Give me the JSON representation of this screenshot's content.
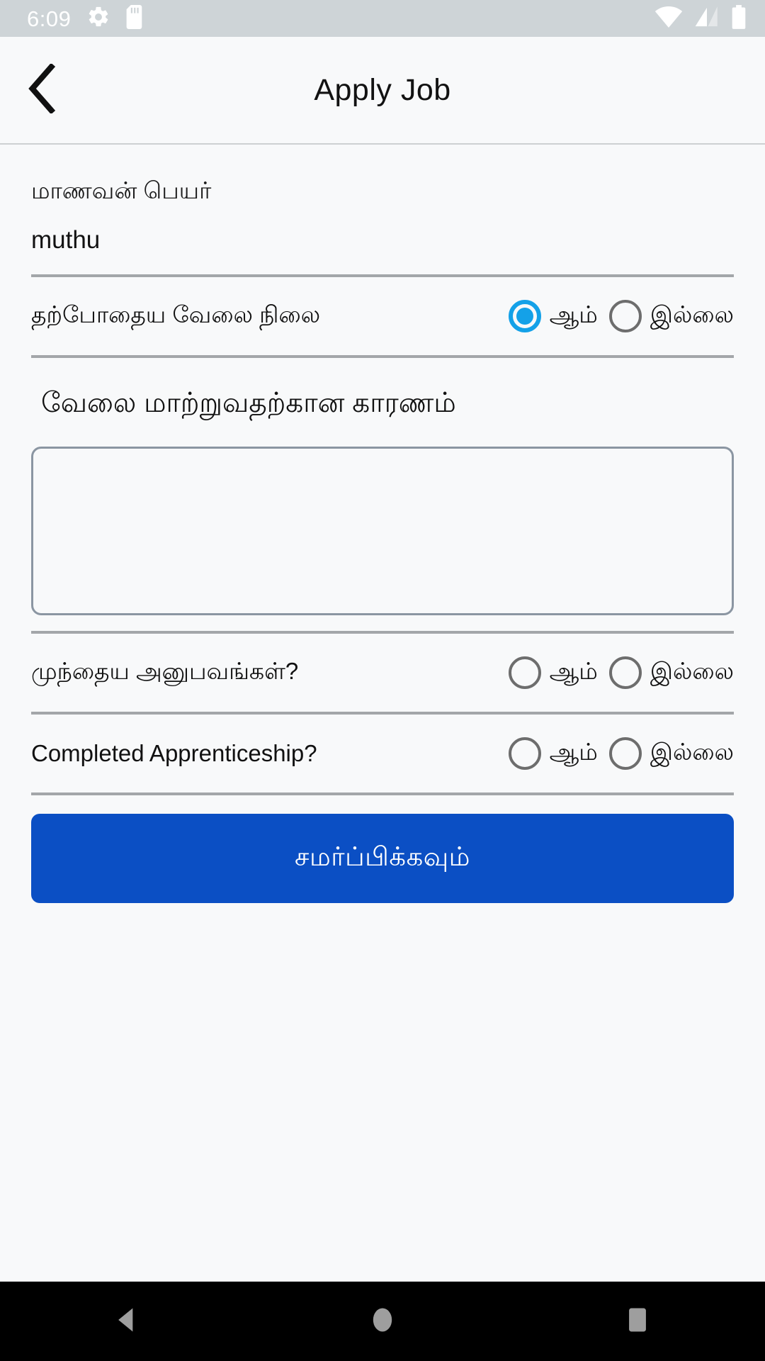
{
  "status_bar": {
    "time": "6:09",
    "left_icons": [
      "settings-gear-icon",
      "sd-card-icon"
    ],
    "right_icons": [
      "wifi-icon",
      "cellular-signal-icon",
      "battery-icon"
    ],
    "background_color": "#ced4d7",
    "icon_color": "#ffffff"
  },
  "app_bar": {
    "back_icon": "chevron-left-icon",
    "title": "Apply Job"
  },
  "form": {
    "student_name": {
      "label": "மாணவன் பெயர்",
      "value": "muthu",
      "placeholder": ""
    },
    "current_job_status": {
      "label": "தற்போதைய வேலை நிலை",
      "options": [
        {
          "label": "ஆம்",
          "selected": true
        },
        {
          "label": "இல்லை",
          "selected": false
        }
      ],
      "selected_color": "#14a1e8"
    },
    "reason_section": {
      "title": "வேலை மாற்றுவதற்கான காரணம்",
      "value": "",
      "placeholder": ""
    },
    "previous_experience": {
      "label": "முந்தைய அனுபவங்கள்?",
      "options": [
        {
          "label": "ஆம்",
          "selected": false
        },
        {
          "label": "இல்லை",
          "selected": false
        }
      ]
    },
    "completed_apprenticeship": {
      "label": "Completed Apprenticeship?",
      "options": [
        {
          "label": "ஆம்",
          "selected": false
        },
        {
          "label": "இல்லை",
          "selected": false
        }
      ]
    },
    "submit_button": {
      "label": "சமர்ப்பிக்கவும்",
      "color": "#0b4fc4",
      "text_color": "#ffffff"
    }
  },
  "nav_bar": {
    "background_color": "#000000",
    "icon_color": "#9e9e9e",
    "buttons": [
      "back-triangle-icon",
      "home-circle-icon",
      "recents-square-icon"
    ]
  }
}
